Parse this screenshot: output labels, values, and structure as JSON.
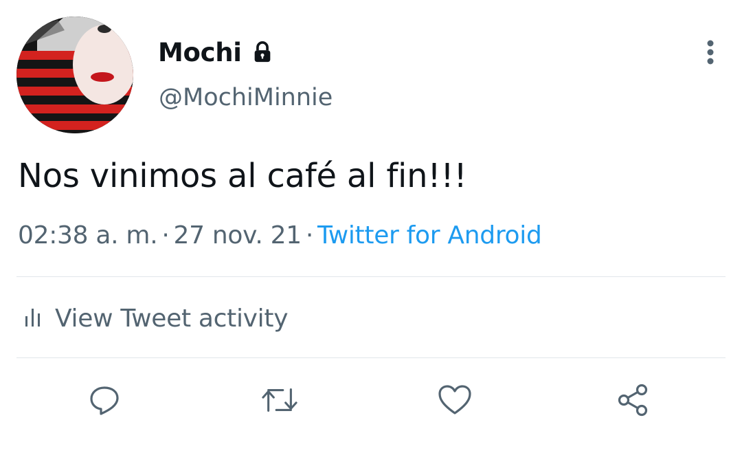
{
  "author": {
    "display_name": "Mochi",
    "handle": "@MochiMinnie",
    "protected_icon": "lock-icon",
    "avatar_icon": "avatar"
  },
  "tweet": {
    "text": "Nos vinimos al café al fin!!!",
    "time": "02:38 a. m.",
    "date": "27 nov. 21",
    "separator": "·",
    "source": "Twitter for Android"
  },
  "activity": {
    "label": "View Tweet activity",
    "icon": "analytics-icon"
  },
  "actions": {
    "reply_icon": "reply-icon",
    "retweet_icon": "retweet-icon",
    "like_icon": "like-icon",
    "share_icon": "share-icon"
  },
  "menu": {
    "more_icon": "more-vertical-icon"
  },
  "colors": {
    "text": "#0f1419",
    "secondary": "#536471",
    "link": "#1d9bf0",
    "divider": "#e1e6ea"
  }
}
